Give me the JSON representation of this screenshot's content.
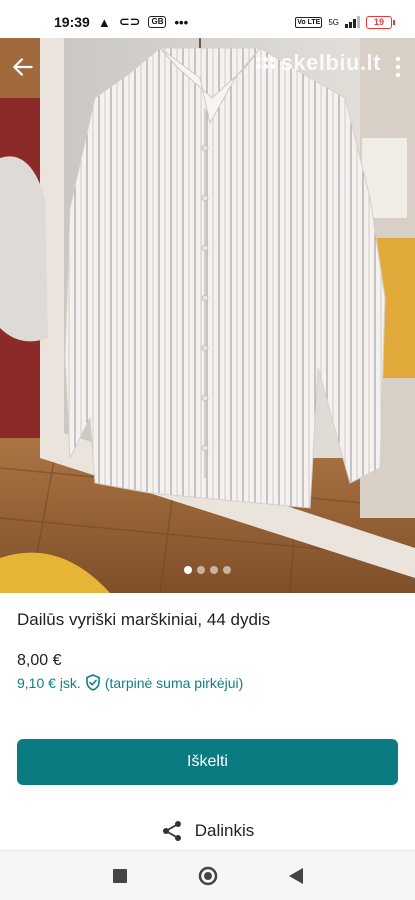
{
  "status_bar": {
    "time": "19:39",
    "warning_icon": "warning-icon",
    "link_icon": "link-icon",
    "box_label": "GB",
    "overflow": "•••",
    "volte_label": "Vo LTE",
    "network_label": "5G",
    "battery_level": "19"
  },
  "photo": {
    "logo_text": "skelbiu.lt",
    "carousel_count": 4,
    "carousel_active_index": 0
  },
  "listing": {
    "title": "Dailūs vyriški marškiniai, 44 dydis",
    "price": "8,00 €",
    "price_incl": "9,10 € įsk.",
    "price_incl_note": "(tarpinė suma pirkėjui)"
  },
  "actions": {
    "promote_label": "Iškelti",
    "share_label": "Dalinkis"
  },
  "colors": {
    "accent": "#0b7b82",
    "accent_text": "#0f7f86"
  }
}
